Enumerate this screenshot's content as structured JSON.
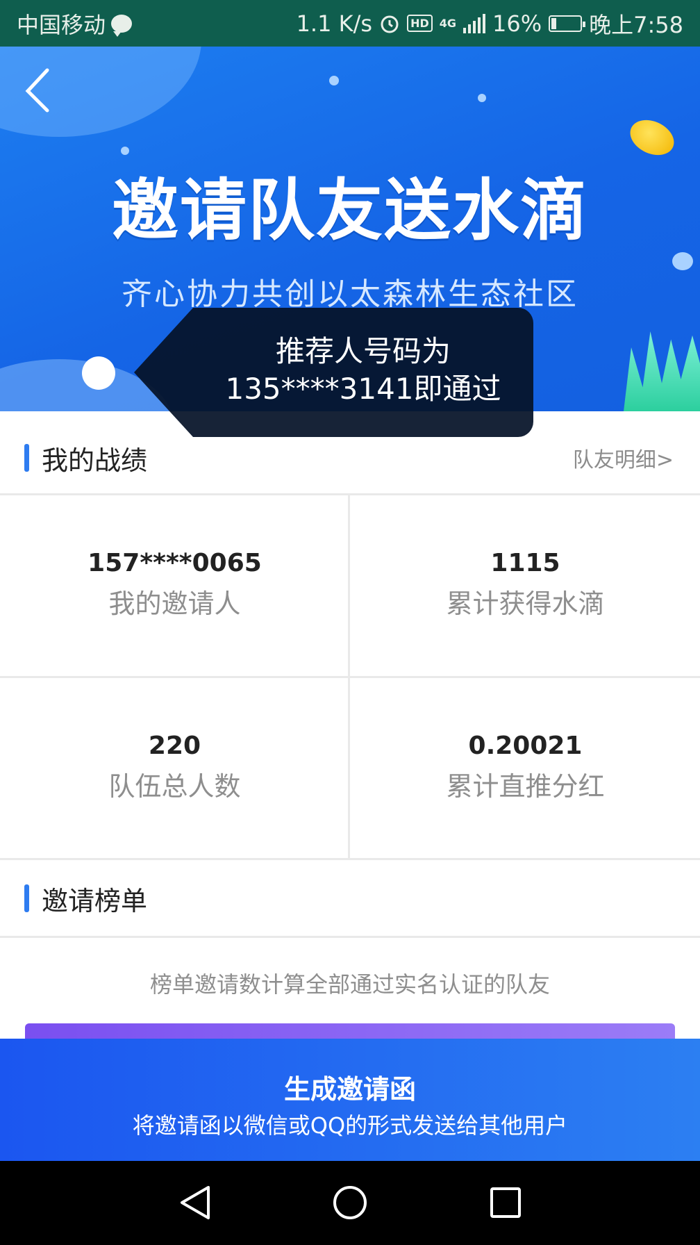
{
  "status_bar": {
    "carrier": "中国移动",
    "speed": "1.1 K/s",
    "hd": "HD",
    "network": "4G",
    "battery": "16%",
    "battery_level": 0.16,
    "time": "晚上7:58"
  },
  "banner": {
    "title": "邀请队友送水滴",
    "subtitle": "齐心协力共创以太森林生态社区"
  },
  "tooltip": {
    "line1": "推荐人号码为",
    "line2": "135****3141即通过"
  },
  "record_section": {
    "title": "我的战绩",
    "link": "队友明细>"
  },
  "stats": [
    {
      "value": "157****0065",
      "label": "我的邀请人"
    },
    {
      "value": "1115",
      "label": "累计获得水滴"
    },
    {
      "value": "220",
      "label": "队伍总人数"
    },
    {
      "value": "0.20021",
      "label": "累计直推分红"
    }
  ],
  "rank_section": {
    "title": "邀请榜单",
    "note": "榜单邀请数计算全部通过实名认证的队友"
  },
  "cta": {
    "label": "生成邀请函",
    "sublabel": "将邀请函以微信或QQ的形式发送给其他用户"
  },
  "colors": {
    "accent": "#2e7cf0",
    "banner_blue": "#1565e6",
    "status_bar": "#0f5e4e"
  }
}
